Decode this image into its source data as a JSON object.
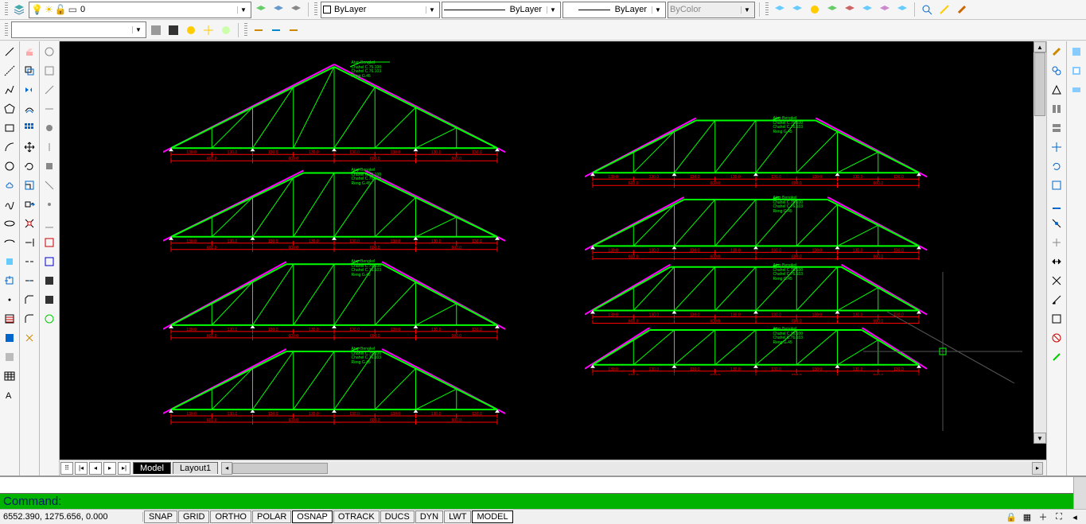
{
  "toolbar1": {
    "layer_dd": "0",
    "color_dd": "ByLayer",
    "linetype_dd": "ByLayer",
    "lineweight_dd": "ByLayer",
    "plotstyle_dd": "ByColor"
  },
  "toolbar2": {
    "dd": ""
  },
  "tabs": {
    "model": "Model",
    "layout1": "Layout1"
  },
  "command": {
    "prompt": "Command:"
  },
  "status": {
    "coords": "6552.390, 1275.656, 0.000",
    "buttons": [
      "SNAP",
      "GRID",
      "ORTHO",
      "POLAR",
      "OSNAP",
      "OTRACK",
      "DUCS",
      "DYN",
      "LWT",
      "MODEL"
    ]
  },
  "annotations": {
    "label": "Atap Bengkel\nChahel C.75.100\nChahel C.76.103\nReng G.45",
    "dims": [
      "130.0",
      "130.0",
      "130.0",
      "130.0",
      "130.0",
      "130.0",
      "130.0",
      "130.0"
    ],
    "spans": [
      "600.0",
      "600.0",
      "600.0",
      "600.0"
    ]
  }
}
